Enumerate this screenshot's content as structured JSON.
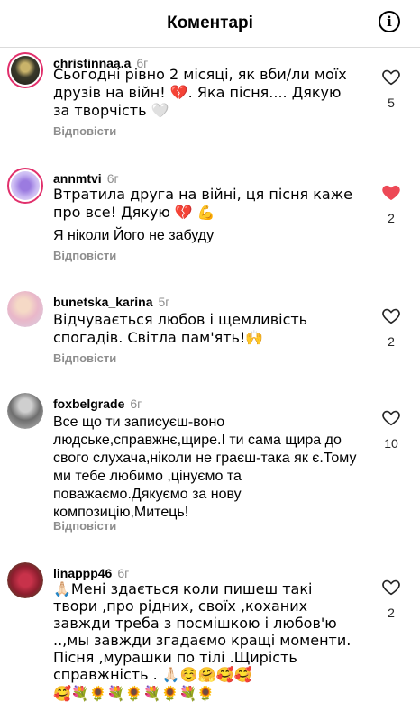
{
  "header": {
    "title": "Коментарі",
    "info_icon": "info-icon"
  },
  "reply_label": "Відповісти",
  "colors": {
    "accent_heart": "#ed4956",
    "muted": "#8e8e8e"
  },
  "comments": [
    {
      "username": "christinnaa.a",
      "time": "6г",
      "lines": [
        "Сьогодні рівно 2 місяці, як вби/ли моїх друзів на війн! 💔. Яка пісня.... Дякую за творчість 🤍"
      ],
      "likes": "5",
      "liked": false
    },
    {
      "username": "annmtvi",
      "time": "6г",
      "lines": [
        "Втратила друга на війні, ця пісня каже про все! Дякую 💔 💪",
        "Я ніколи Його не забуду"
      ],
      "likes": "2",
      "liked": true
    },
    {
      "username": "bunetska_karina",
      "time": "5г",
      "lines": [
        "Відчувається любов і щемливість спогадів. Світла пам'ять!🙌"
      ],
      "likes": "2",
      "liked": false
    },
    {
      "username": "foxbelgrade",
      "time": "6г",
      "lines": [
        "Все що ти записуєш-воно людське,справжнє,щире.І ти сама щира до свого слухача,ніколи не граєш-така як є.Тому ми тебе любимо ,цінуємо та поважаємо.Дякуємо за нову композицію,Митець!"
      ],
      "likes": "10",
      "liked": false
    },
    {
      "username": "linappp46",
      "time": "6г",
      "lines": [
        "🙏🏻Мені здається коли пишеш  такі твори ,про  рідних, своїх ,коханих  завжди треба з  посмішкою  і любов'ю ..,мы завжди згадаємо  кращі моменти. Пісня ,мурашки по тілі .Щирість справжність . 🙏🏻☺️🤗🥰🥰",
        "🥰💐🌻💐🌻💐🌻💐🌻"
      ],
      "likes": "2",
      "liked": false
    }
  ]
}
